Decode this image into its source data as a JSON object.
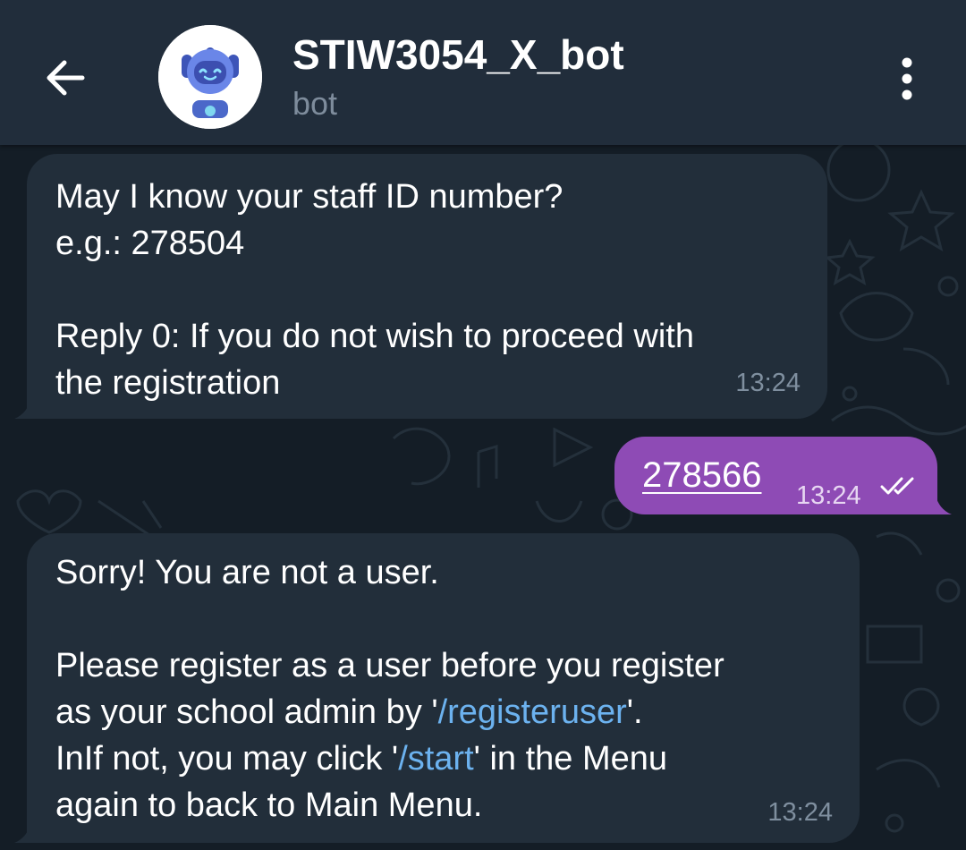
{
  "header": {
    "title": "STIW3054_X_bot",
    "subtitle": "bot"
  },
  "messages": [
    {
      "lines": [
        "May I know your staff ID number?",
        "e.g.: 278504",
        "",
        "Reply 0: If you do not wish to proceed with",
        "the registration"
      ],
      "time": "13:24"
    },
    {
      "text": "278566",
      "time": "13:24"
    },
    {
      "line1": "Sorry! You are not a user.",
      "line3": "Please register as a user before you register",
      "line4_pre": "as your school admin by '",
      "line4_link": "/registeruser",
      "line4_post": "'.",
      "line5_pre": "InIf not, you may click '",
      "line5_link": "/start",
      "line5_post": "' in the Menu",
      "line6": "again to back to Main Menu.",
      "time": "13:24"
    }
  ],
  "colors": {
    "header_bg": "#212d3b",
    "incoming_bubble": "#222e3a",
    "outgoing_bubble": "#8e4bb5",
    "link": "#6cb2ef",
    "timestamp": "#7f8f9f"
  },
  "icons": {
    "back": "arrow-left-icon",
    "menu": "more-vertical-icon",
    "read": "double-check-icon"
  }
}
